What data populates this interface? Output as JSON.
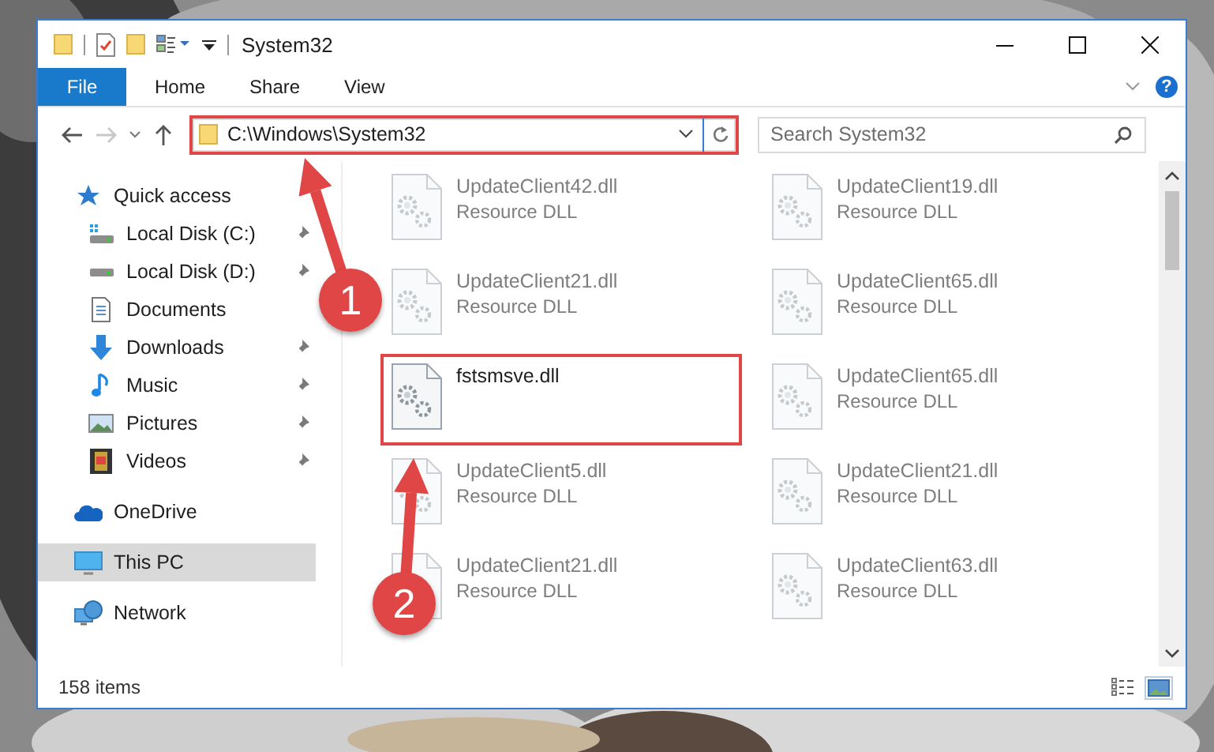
{
  "window": {
    "title": "System32"
  },
  "ribbon": {
    "tabs": [
      {
        "label": "File",
        "kind": "file"
      },
      {
        "label": "Home",
        "kind": "tab"
      },
      {
        "label": "Share",
        "kind": "tab"
      },
      {
        "label": "View",
        "kind": "tab"
      }
    ],
    "help": "?"
  },
  "address": {
    "path": "C:\\Windows\\System32",
    "highlighted": true
  },
  "search": {
    "placeholder": "Search System32"
  },
  "sidebar": {
    "items": [
      {
        "label": "Quick access",
        "kind": "star",
        "children": [
          {
            "label": "Local Disk (C:)",
            "kind": "system-drive",
            "pinned": true
          },
          {
            "label": "Local Disk (D:)",
            "kind": "drive",
            "pinned": true
          },
          {
            "label": "Documents",
            "kind": "documents"
          },
          {
            "label": "Downloads",
            "kind": "downloads",
            "pinned": true
          },
          {
            "label": "Music",
            "kind": "music",
            "pinned": true
          },
          {
            "label": "Pictures",
            "kind": "pictures",
            "pinned": true
          },
          {
            "label": "Videos",
            "kind": "videos",
            "pinned": true
          }
        ]
      },
      {
        "label": "OneDrive",
        "kind": "cloud",
        "selected": false
      },
      {
        "label": "This PC",
        "kind": "pc",
        "selected": true
      },
      {
        "label": "Network",
        "kind": "network",
        "selected": false
      }
    ]
  },
  "files": [
    {
      "name": "UpdateClient42.dll",
      "type": "Resource DLL",
      "blurred": true,
      "highlighted": false
    },
    {
      "name": "UpdateClient19.dll",
      "type": "Resource DLL",
      "blurred": true,
      "highlighted": false
    },
    {
      "name": "UpdateClient21.dll",
      "type": "Resource DLL",
      "blurred": true,
      "highlighted": false
    },
    {
      "name": "UpdateClient65.dll",
      "type": "Resource DLL",
      "blurred": true,
      "highlighted": false
    },
    {
      "name": "fstsmsve.dll",
      "blurred": false,
      "highlighted": true
    },
    {
      "name": "UpdateClient65.dll",
      "type": "Resource DLL",
      "blurred": true,
      "highlighted": false
    },
    {
      "name": "UpdateClient5.dll",
      "type": "Resource DLL",
      "blurred": true,
      "highlighted": false
    },
    {
      "name": "UpdateClient21.dll",
      "type": "Resource DLL",
      "blurred": true,
      "highlighted": false
    },
    {
      "name": "UpdateClient21.dll",
      "type": "Resource DLL",
      "blurred": true,
      "highlighted": false
    },
    {
      "name": "UpdateClient63.dll",
      "type": "Resource DLL",
      "blurred": true,
      "highlighted": false
    }
  ],
  "annotations": [
    {
      "label": "1"
    },
    {
      "label": "2"
    }
  ],
  "status_bar": {
    "count": "158 items"
  }
}
